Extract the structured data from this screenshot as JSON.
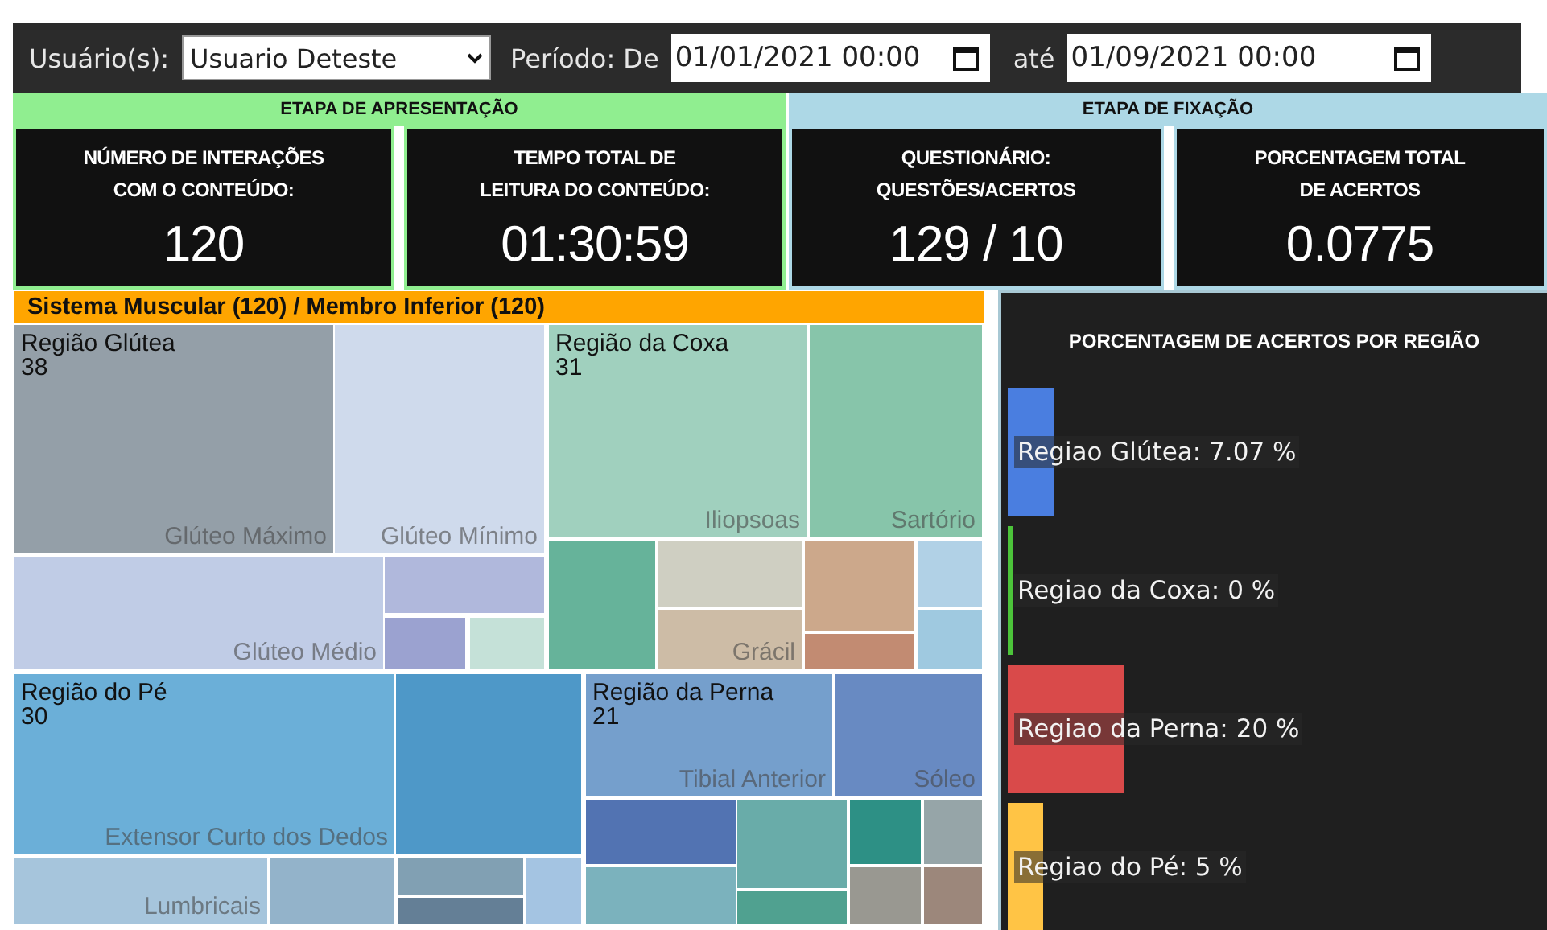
{
  "filters": {
    "user_label": "Usuário(s):",
    "user_value": "Usuario Deteste",
    "period_label": "Período: De",
    "date_from": "01/01/2021 00:00",
    "until_label": "até",
    "date_to": "01/09/2021 00:00"
  },
  "stages": [
    {
      "title": "ETAPA DE APRESENTAÇÃO",
      "color": "#90ee90",
      "cards": [
        {
          "label_lines": [
            "NÚMERO DE INTERAÇÕES",
            "COM O CONTEÚDO:"
          ],
          "value": "120"
        },
        {
          "label_lines": [
            "TEMPO TOTAL DE",
            "LEITURA DO CONTEÚDO:"
          ],
          "value": "01:30:59"
        }
      ]
    },
    {
      "title": "ETAPA DE FIXAÇÃO",
      "color": "#add8e6",
      "cards": [
        {
          "label_lines": [
            "QUESTIONÁRIO:",
            "QUESTÕES/ACERTOS"
          ],
          "value": "129 / 10"
        },
        {
          "label_lines": [
            "PORCENTAGEM TOTAL",
            "DE ACERTOS"
          ],
          "value": "0.0775"
        }
      ]
    }
  ],
  "treemap": {
    "title": "Sistema Muscular (120) / Membro Inferior (120)",
    "regions": [
      {
        "name": "Região Glútea",
        "count": "38",
        "cells": [
          {
            "label": "Glúteo Máximo",
            "color": "#949fa8"
          },
          {
            "label": "Glúteo Mínimo",
            "color": "#cfdaec"
          },
          {
            "label": "Glúteo Médio",
            "color": "#c0cce6"
          },
          {
            "color": "#b0b8dc"
          },
          {
            "color": "#9ba2d0"
          },
          {
            "color": "#c5e1d8"
          }
        ]
      },
      {
        "name": "Região da Coxa",
        "count": "31",
        "cells": [
          {
            "label": "Iliopsoas",
            "color": "#a0d0be"
          },
          {
            "label": "Sartório",
            "color": "#87c5aa"
          },
          {
            "color": "#66b39a"
          },
          {
            "color": "#cfcfc2"
          },
          {
            "label": "Grácil",
            "color": "#cdbca6"
          },
          {
            "color": "#cca88b"
          },
          {
            "color": "#c28b72"
          },
          {
            "color": "#b1d1e6"
          },
          {
            "color": "#9fc9e0"
          }
        ]
      },
      {
        "name": "Região do Pé",
        "count": "30",
        "cells": [
          {
            "label": "Extensor Curto dos Dedos",
            "color": "#6bafd8"
          },
          {
            "color": "#4e98c8"
          },
          {
            "label": "Lumbricais",
            "color": "#a6c5dc"
          },
          {
            "color": "#93b3ca"
          },
          {
            "color": "#81a0b3"
          },
          {
            "color": "#647f96"
          },
          {
            "color": "#a4c4e2"
          }
        ]
      },
      {
        "name": "Região da Perna",
        "count": "21",
        "cells": [
          {
            "label": "Tibial Anterior",
            "color": "#759fcc"
          },
          {
            "label": "Sóleo",
            "color": "#688ac2"
          },
          {
            "color": "#5273b2"
          },
          {
            "color": "#69aca9"
          },
          {
            "color": "#7bb2bd"
          },
          {
            "color": "#50a190"
          },
          {
            "color": "#2d9085"
          },
          {
            "color": "#96a5a8"
          },
          {
            "color": "#999891"
          },
          {
            "color": "#9c877b"
          }
        ]
      }
    ]
  },
  "chart": {
    "title": "PORCENTAGEM DE ACERTOS POR REGIÃO",
    "bars": [
      {
        "label": "Regiao Glútea: 7.07 %",
        "color": "#4a7ee0"
      },
      {
        "label": "Regiao da Coxa: 0 %",
        "color": "#4cc43a"
      },
      {
        "label": "Regiao da Perna: 20 %",
        "color": "#d94a4a"
      },
      {
        "label": "Regiao do Pé: 5 %",
        "color": "#ffc445"
      }
    ]
  }
}
